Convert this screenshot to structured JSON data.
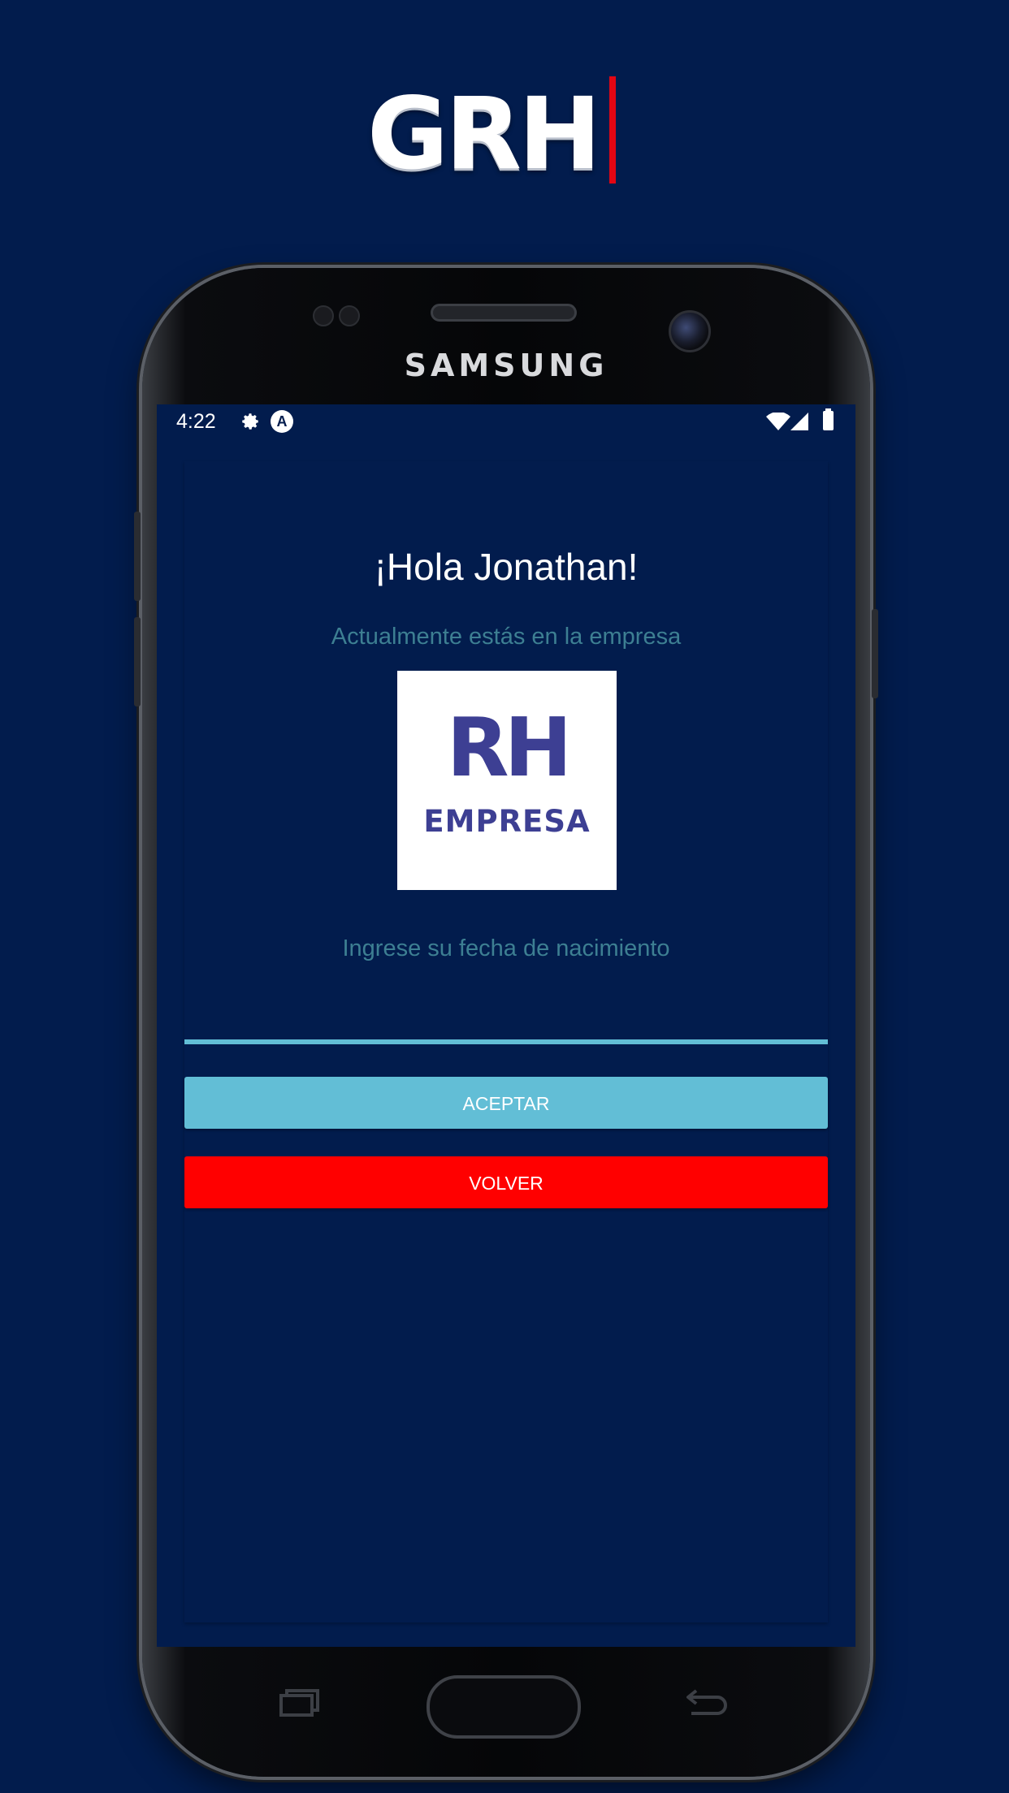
{
  "brand": {
    "logo_text": "GRH",
    "accent_color": "#e30613"
  },
  "device": {
    "maker": "SAMSUNG"
  },
  "status_bar": {
    "time": "4:22",
    "icons": [
      "settings-gear-icon",
      "a-badge-icon",
      "wifi-icon",
      "signal-icon",
      "battery-icon"
    ],
    "badge_letter": "A"
  },
  "screen": {
    "greeting": "¡Hola Jonathan!",
    "company_label": "Actualmente estás en la empresa",
    "company_logo": {
      "line1": "RH",
      "line2": "EMPRESA",
      "color": "#3d3f93"
    },
    "birthdate_label": "Ingrese su fecha de nacimiento",
    "birthdate_value": "",
    "accept_button": "ACEPTAR",
    "back_button": "VOLVER"
  },
  "colors": {
    "background": "#021c4d",
    "accent_teal": "#62bed6",
    "label_teal": "#3d7f92",
    "back_red": "#ff0000"
  },
  "nav_bar": {
    "icons": [
      "recents-icon",
      "home-button",
      "back-icon"
    ]
  }
}
